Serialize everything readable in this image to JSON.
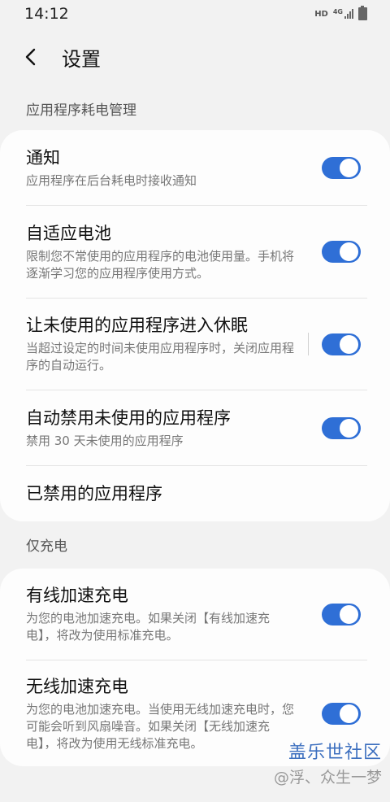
{
  "status_bar": {
    "time": "14:12",
    "hd": "HD",
    "network": "4G"
  },
  "header": {
    "title": "设置"
  },
  "sections": [
    {
      "header": "应用程序耗电管理",
      "items": [
        {
          "title": "通知",
          "subtitle": "应用程序在后台耗电时接收通知",
          "toggle": true
        },
        {
          "title": "自适应电池",
          "subtitle": "限制您不常使用的应用程序的电池使用量。手机将逐渐学习您的应用程序使用方式。",
          "toggle": true
        },
        {
          "title": "让未使用的应用程序进入休眠",
          "subtitle": "当超过设定的时间未使用应用程序时，关闭应用程序的自动运行。",
          "toggle": true
        },
        {
          "title": "自动禁用未使用的应用程序",
          "subtitle": "禁用 30 天未使用的应用程序",
          "toggle": true
        },
        {
          "title": "已禁用的应用程序"
        }
      ]
    },
    {
      "header": "仅充电",
      "items": [
        {
          "title": "有线加速充电",
          "subtitle": "为您的电池加速充电。如果关闭【有线加速充电】，将改为使用标准充电。",
          "toggle": true
        },
        {
          "title": "无线加速充电",
          "subtitle": "为您的电池加速充电。当使用无线加速充电时，您可能会听到风扇噪音。如果关闭【无线加速充电】，将改为使用无线标准充电。",
          "toggle": true
        }
      ]
    }
  ],
  "watermark": {
    "brand": "盖乐世社区",
    "user": "@浮、众生一梦"
  },
  "colors": {
    "accent": "#2f6fd6",
    "background": "#f2f2f2",
    "card": "#fdfdfd"
  }
}
